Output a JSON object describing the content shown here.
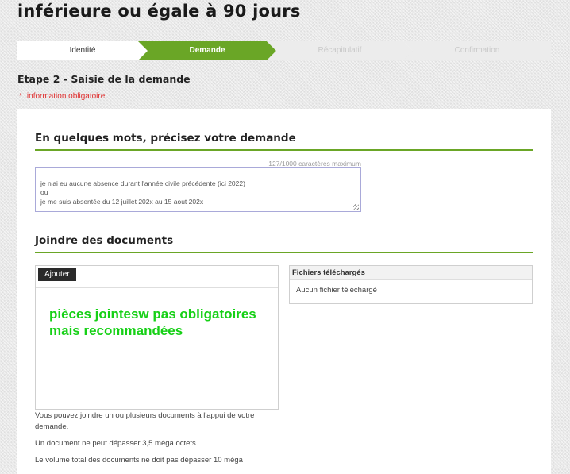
{
  "page": {
    "title": "inférieure ou égale à 90 jours"
  },
  "stepper": {
    "steps": [
      {
        "label": "Identité"
      },
      {
        "label": "Demande"
      },
      {
        "label": "Récapitulatif"
      },
      {
        "label": "Confirmation"
      }
    ],
    "active_step": 2
  },
  "step_heading": "Etape 2 - Saisie de la demande",
  "required_note": {
    "marker": "*",
    "text": "information obligatoire"
  },
  "request_section": {
    "title": "En quelques mots, précisez votre demande",
    "char_counter": "127/1000 caractères maximum",
    "textarea_value": "je n'ai eu aucune absence durant l'année civile précédente (ici 2022)\nou\nje me suis absentée du 12 juillet 202x au 15 aout 202x"
  },
  "documents_section": {
    "title": "Joindre des documents",
    "add_button": "Ajouter",
    "annotation": "pièces jointesw pas obligatoires\nmais recommandées",
    "files_header": "Fichiers téléchargés",
    "files_empty": "Aucun fichier téléchargé",
    "help_1": "Vous pouvez joindre un ou plusieurs documents à l'appui de votre demande.",
    "help_2": "Un document ne peut dépasser 3,5 méga octets.",
    "help_3": "Le volume total des documents ne doit pas dépasser 10 méga"
  },
  "colors": {
    "accent": "#6aa626",
    "required": "#e03030",
    "annotation": "#16d016"
  }
}
